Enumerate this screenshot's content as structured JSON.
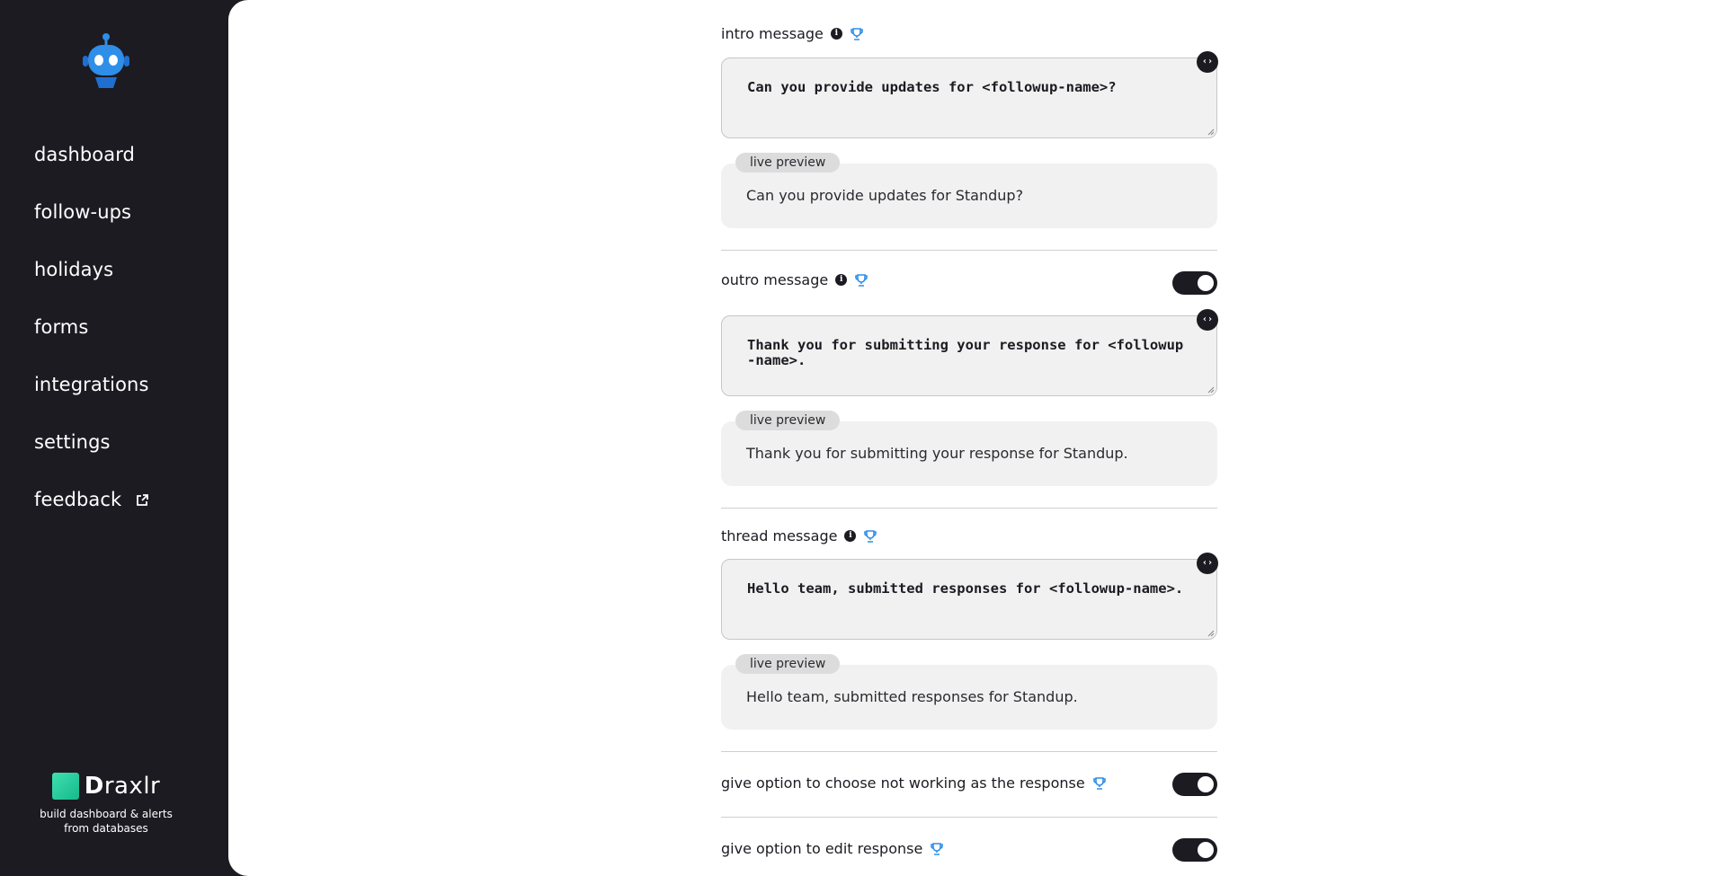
{
  "sidebar": {
    "logo_icon": "robot-icon",
    "nav": [
      {
        "label": "dashboard"
      },
      {
        "label": "follow-ups"
      },
      {
        "label": "holidays"
      },
      {
        "label": "forms"
      },
      {
        "label": "integrations"
      },
      {
        "label": "settings"
      },
      {
        "label": "feedback",
        "icon": "external-link-icon"
      }
    ],
    "brand": {
      "name_bold": "D",
      "name_rest": "raxlr",
      "tagline_line1": "build dashboard & alerts",
      "tagline_line2": "from databases"
    }
  },
  "colors": {
    "sidebar_bg": "#1c1b22",
    "accent_blue": "#2f8ee8",
    "brand_green": "#1fc99a",
    "field_bg": "#f1f1f1"
  },
  "form": {
    "intro": {
      "label": "intro message",
      "template": "Can you provide updates for <followup-name>?",
      "preview_tag": "live preview",
      "preview": "Can you provide updates for Standup?"
    },
    "outro": {
      "label": "outro message",
      "enabled": true,
      "template": "Thank you for submitting your response for <followup-name>.",
      "preview_tag": "live preview",
      "preview": "Thank you for submitting your response for Standup."
    },
    "thread": {
      "label": "thread message",
      "template": "Hello team, submitted responses for <followup-name>.",
      "preview_tag": "live preview",
      "preview": "Hello team, submitted responses for Standup."
    },
    "not_working_option": {
      "label": "give option to choose not working as the response",
      "enabled": true
    },
    "edit_response_option": {
      "label": "give option to edit response",
      "enabled": true
    },
    "code_button_glyph": "‹›"
  }
}
